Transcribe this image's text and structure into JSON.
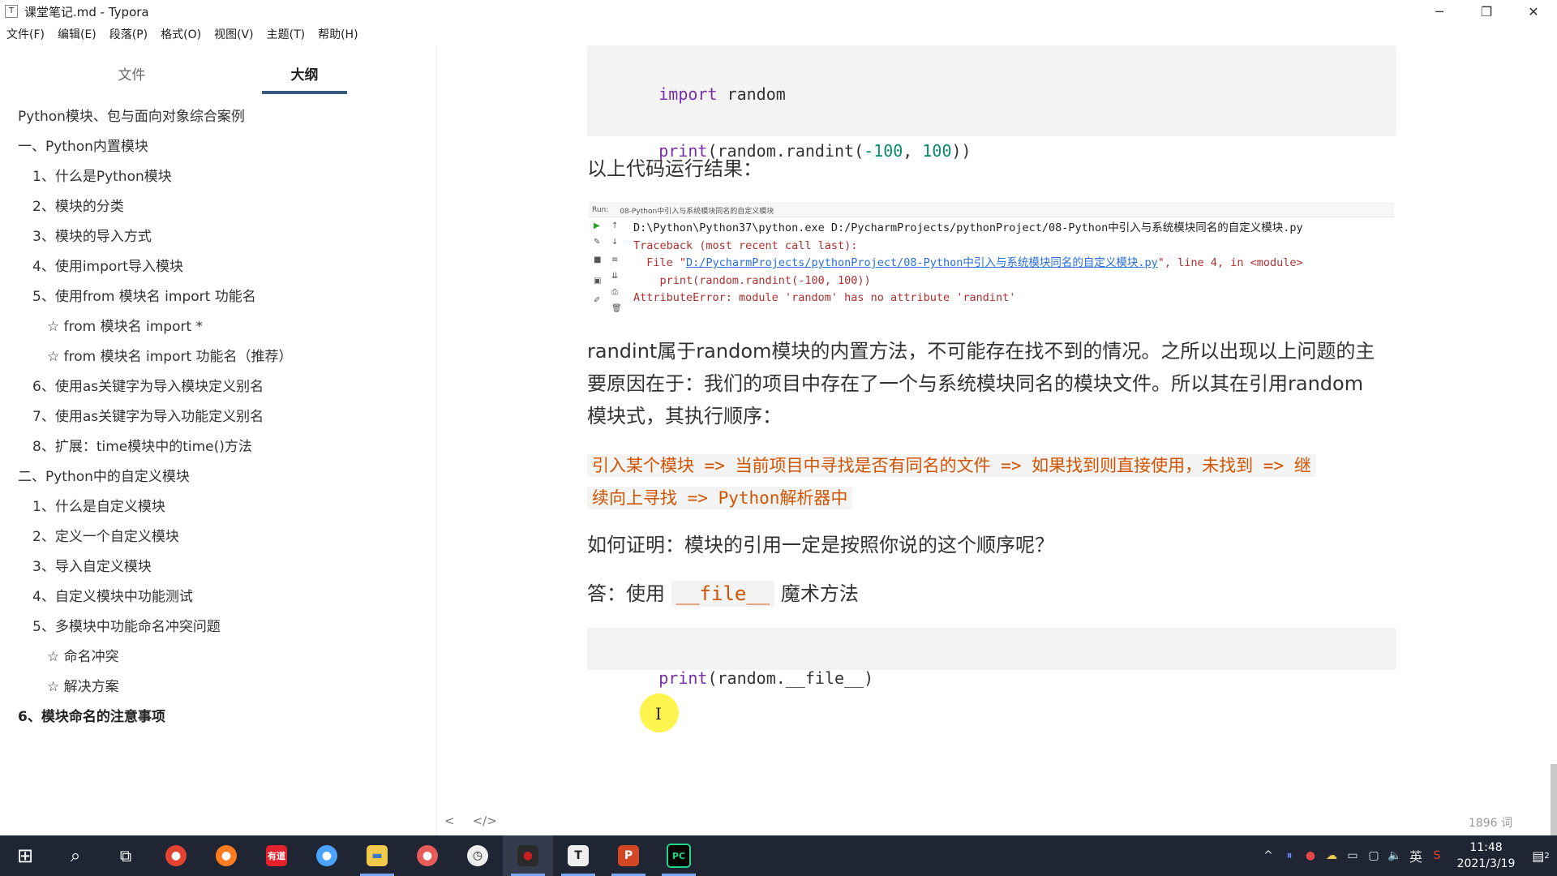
{
  "window": {
    "title": "课堂笔记.md - Typora",
    "app_icon": "T",
    "minimize": "─",
    "maximize": "❐",
    "close": "✕"
  },
  "menu": [
    "文件(F)",
    "编辑(E)",
    "段落(P)",
    "格式(O)",
    "视图(V)",
    "主题(T)",
    "帮助(H)"
  ],
  "sidebar": {
    "tabs": [
      "文件",
      "大纲"
    ],
    "active_tab": "大纲",
    "outline": [
      "Python模块、包与面向对象综合案例",
      "一、Python内置模块",
      "1、什么是Python模块",
      "2、模块的分类",
      "3、模块的导入方式",
      "4、使用import导入模块",
      "5、使用from 模块名 import 功能名",
      "☆ from 模块名 import *",
      "☆ from 模块名 import 功能名（推荐）",
      "6、使用as关键字为导入模块定义别名",
      "7、使用as关键字为导入功能定义别名",
      "8、扩展：time模块中的time()方法",
      "二、Python中的自定义模块",
      "1、什么是自定义模块",
      "2、定义一个自定义模块",
      "3、导入自定义模块",
      "4、自定义模块中功能测试",
      "5、多模块中功能命名冲突问题",
      "☆ 命名冲突",
      "☆ 解决方案",
      "6、模块命名的注意事项"
    ]
  },
  "editor": {
    "code1": {
      "kw_import": "import",
      "mod": " random",
      "print": "print",
      "call_start": "(random.randint(",
      "n1": "-100",
      "sep": ", ",
      "n2": "100",
      "call_end": "))"
    },
    "result_heading": "以上代码运行结果：",
    "run_panel": {
      "tab_label": "Run:",
      "tab_name": "08-Python中引入与系统模块同名的自定义模块",
      "line1": "D:\\Python\\Python37\\python.exe D:/PycharmProjects/pythonProject/08-Python中引入与系统模块同名的自定义模块.py",
      "line2": "Traceback (most recent call last):",
      "line3_prefix": "  File \"",
      "line3_link": "D:/PycharmProjects/pythonProject/08-Python中引入与系统模块同名的自定义模块.py",
      "line3_suffix": "\", line 4, in <module>",
      "line4": "    print(random.randint(-100, 100))",
      "line5": "AttributeError: module 'random' has no attribute 'randint'"
    },
    "para1_line1": "randint属于random模块的内置方法，不可能存在找不到的情况。之所以出现以上问题的主",
    "para1_line2": "要原因在于：我们的项目中存在了一个与系统模块同名的模块文件。所以其在引用random",
    "para1_line3": "模块式，其执行顺序：",
    "order_line1": "引入某个模块 => 当前项目中寻找是否有同名的文件 => 如果找到则直接使用，未找到 => 继",
    "order_line2": "续向上寻找 => Python解析器中",
    "question": "如何证明：模块的引用一定是按照你说的这个顺序呢？",
    "answer_prefix": "答：使用 ",
    "answer_code": "__file__",
    "answer_suffix": " 魔术方法",
    "code2": {
      "print": "print",
      "rest": "(random.__file__)"
    },
    "text_cursor": "I"
  },
  "status": {
    "back": "<",
    "source": "</>",
    "word_count": "1896 词"
  },
  "taskbar": {
    "start": "⊞",
    "search": "⌕",
    "taskview": "⧉",
    "apps": [
      {
        "name": "chrome",
        "label": "●",
        "color": "#e4442f"
      },
      {
        "name": "firefox",
        "label": "●",
        "color": "#ff7b1f"
      },
      {
        "name": "youdao",
        "label": "有道",
        "color": "#e6202c"
      },
      {
        "name": "browser",
        "label": "●",
        "color": "#4aa3ff"
      },
      {
        "name": "explorer",
        "label": "▬",
        "color": "#f2c94c"
      },
      {
        "name": "screenshot",
        "label": "●",
        "color": "#e85b5b"
      },
      {
        "name": "clock-app",
        "label": "◷",
        "color": "#eeeeee"
      },
      {
        "name": "recorder",
        "label": "●",
        "color": "#c52020"
      },
      {
        "name": "typora",
        "label": "T",
        "color": "#eeeeee"
      },
      {
        "name": "powerpoint",
        "label": "P",
        "color": "#d24726"
      },
      {
        "name": "pycharm",
        "label": "PC",
        "color": "#21d789"
      }
    ],
    "tray": {
      "chevron": "^",
      "ime": "英",
      "volume": "🔈",
      "time": "11:48",
      "date": "2021/3/19",
      "notifications": "2"
    }
  },
  "colors": {
    "keyword": "#7a2ea8",
    "number": "#0a8a6a",
    "inline_code": "#d35400",
    "active_tab_underline": "#375a7f",
    "taskbar": "#1f2533"
  }
}
